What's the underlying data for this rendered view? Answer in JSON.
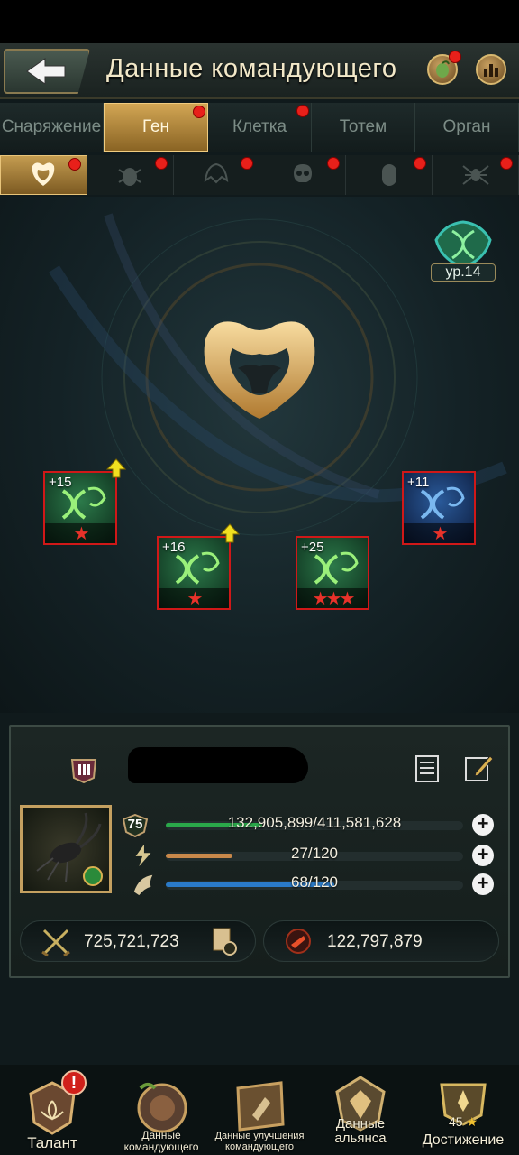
{
  "header": {
    "title": "Данные командующего"
  },
  "tabs": [
    {
      "label": "Снаряжение",
      "active": false,
      "dot": false
    },
    {
      "label": "Ген",
      "active": true,
      "dot": true
    },
    {
      "label": "Клетка",
      "active": false,
      "dot": true
    },
    {
      "label": "Тотем",
      "active": false,
      "dot": false
    },
    {
      "label": "Орган",
      "active": false,
      "dot": false
    }
  ],
  "subtabs": [
    {
      "icon": "bull-crest-icon",
      "active": true
    },
    {
      "icon": "beetle-icon",
      "active": false
    },
    {
      "icon": "helmet-icon",
      "active": false
    },
    {
      "icon": "skull-icon",
      "active": false
    },
    {
      "icon": "capsule-icon",
      "active": false
    },
    {
      "icon": "spider-icon",
      "active": false
    }
  ],
  "gene_level": {
    "label": "ур.14"
  },
  "gene_cards": [
    {
      "plus": "+15",
      "stars": 1,
      "color": "green",
      "upgrade": true
    },
    {
      "plus": "+16",
      "stars": 1,
      "color": "green",
      "upgrade": true
    },
    {
      "plus": "+25",
      "stars": 3,
      "color": "green",
      "upgrade": false
    },
    {
      "plus": "+11",
      "stars": 1,
      "color": "blue",
      "upgrade": false
    }
  ],
  "commander": {
    "level": "75",
    "stats": [
      {
        "name": "experience",
        "text": "132,905,899/411,581,628",
        "fraction": 0.323,
        "color": "#2aa84a"
      },
      {
        "name": "energy",
        "text": "27/120",
        "fraction": 0.225,
        "color": "#c8884a"
      },
      {
        "name": "stamina",
        "text": "68/120",
        "fraction": 0.567,
        "color": "#2a7ac8"
      }
    ],
    "power": "725,721,723",
    "kills": "122,797,879"
  },
  "bottom_nav": [
    {
      "label": "Талант",
      "icon": "talent-icon",
      "alert": true
    },
    {
      "label": "Данные командующего",
      "line1": "Данные",
      "line2": "командующего",
      "icon": "commander-data-icon"
    },
    {
      "label": "Данные улучшения командующего",
      "line1": "Данные улучшения",
      "line2": "командующего",
      "icon": "upgrade-data-icon"
    },
    {
      "label": "Данные альянса",
      "line1": "Данные",
      "line2": "альянса",
      "icon": "alliance-data-icon"
    },
    {
      "label": "Достижение",
      "icon": "achievement-icon",
      "count": "45"
    }
  ],
  "colors": {
    "accent_gold": "#d2a654",
    "alert_red": "#e8201a",
    "panel_bg": "#1c2624"
  }
}
